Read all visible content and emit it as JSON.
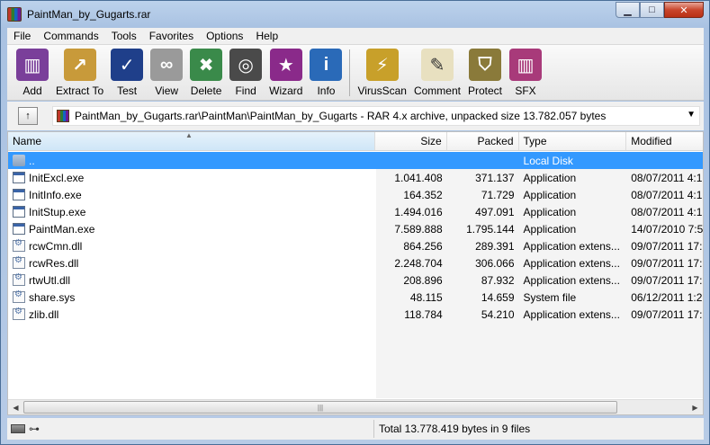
{
  "window": {
    "title": "PaintMan_by_Gugarts.rar",
    "controls": {
      "minimize": "▁",
      "maximize": "□",
      "close": "✕"
    }
  },
  "menu": [
    "File",
    "Commands",
    "Tools",
    "Favorites",
    "Options",
    "Help"
  ],
  "toolbar": [
    {
      "label": "Add",
      "icon": "books-stack-icon",
      "color": "#7a3f9a"
    },
    {
      "label": "Extract To",
      "icon": "folder-extract-icon",
      "color": "#c89a3a"
    },
    {
      "label": "Test",
      "icon": "book-check-icon",
      "color": "#1f3f8a"
    },
    {
      "label": "View",
      "icon": "glasses-icon",
      "color": "#9a9a9a"
    },
    {
      "label": "Delete",
      "icon": "trash-icon",
      "color": "#3a8a4a"
    },
    {
      "label": "Find",
      "icon": "binoculars-icon",
      "color": "#4a4a4a"
    },
    {
      "label": "Wizard",
      "icon": "wizard-icon",
      "color": "#8a2a8a"
    },
    {
      "label": "Info",
      "icon": "info-icon",
      "color": "#2a6ab8"
    },
    {
      "label": "VirusScan",
      "icon": "virus-scan-icon",
      "color": "#c8a02a"
    },
    {
      "label": "Comment",
      "icon": "comment-icon",
      "color": "#e8e0c0"
    },
    {
      "label": "Protect",
      "icon": "shield-icon",
      "color": "#8a7a3a"
    },
    {
      "label": "SFX",
      "icon": "sfx-books-icon",
      "color": "#a83a7a"
    }
  ],
  "address": {
    "up_label": "↑",
    "path": "PaintMan_by_Gugarts.rar\\PaintMan\\PaintMan_by_Gugarts - RAR 4.x archive, unpacked size 13.782.057 bytes",
    "dropdown": "▼"
  },
  "columns": {
    "name": "Name",
    "size": "Size",
    "packed": "Packed",
    "type": "Type",
    "modified": "Modified",
    "sort_indicator": "▲"
  },
  "files": [
    {
      "name": "..",
      "size": "",
      "packed": "",
      "type": "Local Disk",
      "modified": "",
      "kind": "folder",
      "selected": true
    },
    {
      "name": "InitExcl.exe",
      "size": "1.041.408",
      "packed": "371.137",
      "type": "Application",
      "modified": "08/07/2011 4:1",
      "kind": "exe"
    },
    {
      "name": "InitInfo.exe",
      "size": "164.352",
      "packed": "71.729",
      "type": "Application",
      "modified": "08/07/2011 4:1",
      "kind": "exe"
    },
    {
      "name": "InitStup.exe",
      "size": "1.494.016",
      "packed": "497.091",
      "type": "Application",
      "modified": "08/07/2011 4:1",
      "kind": "exe"
    },
    {
      "name": "PaintMan.exe",
      "size": "7.589.888",
      "packed": "1.795.144",
      "type": "Application",
      "modified": "14/07/2010 7:5",
      "kind": "exe"
    },
    {
      "name": "rcwCmn.dll",
      "size": "864.256",
      "packed": "289.391",
      "type": "Application extens...",
      "modified": "09/07/2011 17:",
      "kind": "dll"
    },
    {
      "name": "rcwRes.dll",
      "size": "2.248.704",
      "packed": "306.066",
      "type": "Application extens...",
      "modified": "09/07/2011 17:",
      "kind": "dll"
    },
    {
      "name": "rtwUtl.dll",
      "size": "208.896",
      "packed": "87.932",
      "type": "Application extens...",
      "modified": "09/07/2011 17:",
      "kind": "dll"
    },
    {
      "name": "share.sys",
      "size": "48.115",
      "packed": "14.659",
      "type": "System file",
      "modified": "06/12/2011 1:2",
      "kind": "dll"
    },
    {
      "name": "zlib.dll",
      "size": "118.784",
      "packed": "54.210",
      "type": "Application extens...",
      "modified": "09/07/2011 17:",
      "kind": "dll"
    }
  ],
  "scrollbar": {
    "left": "◀",
    "right": "▶",
    "grip": "|||"
  },
  "status": {
    "text": "Total 13.778.419 bytes in 9 files",
    "key": "⊶"
  }
}
